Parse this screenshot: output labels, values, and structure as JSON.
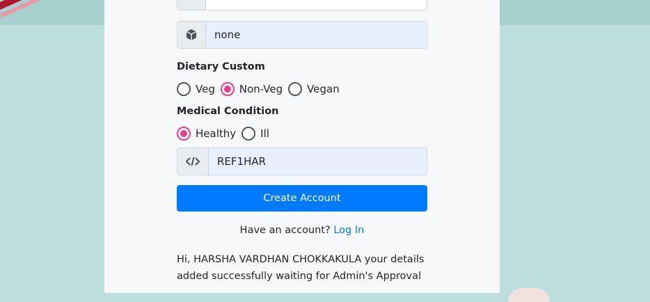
{
  "form": {
    "top_field": {
      "icon": "list-icon",
      "value": ""
    },
    "allergy_field": {
      "icon": "cube-icon",
      "value": "none"
    },
    "dietary": {
      "label": "Dietary Custom",
      "options": [
        {
          "label": "Veg",
          "checked": false
        },
        {
          "label": "Non-Veg",
          "checked": true
        },
        {
          "label": "Vegan",
          "checked": false
        }
      ]
    },
    "medical": {
      "label": "Medical Condition",
      "options": [
        {
          "label": "Healthy",
          "checked": true
        },
        {
          "label": "Ill",
          "checked": false
        }
      ]
    },
    "referral_field": {
      "icon": "code-icon",
      "value": "REF1HAR"
    },
    "submit_label": "Create Account",
    "have_account_text": "Have an account?",
    "login_link": "Log In",
    "message": "Hi, HARSHA VARDHAN CHOKKAKULA your details added successfully waiting for Admin's Approval"
  },
  "colors": {
    "accent": "#007bff",
    "radio_checked": "#e83e8c",
    "field_bg": "#e8f0fe",
    "page_bg": "#bcdedd"
  }
}
